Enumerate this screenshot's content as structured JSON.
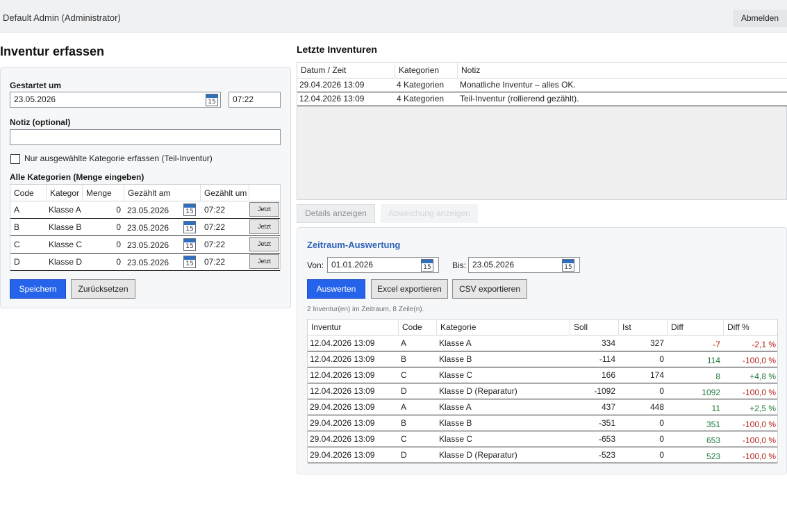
{
  "header": {
    "user": "Default Admin (Administrator)",
    "logout_label": "Abmelden"
  },
  "capture": {
    "title": "Inventur erfassen",
    "started_label": "Gestartet um",
    "started_date": "23.05.2026",
    "started_time": "07:22",
    "calendar_day": "15",
    "note_label": "Notiz (optional)",
    "note_value": "",
    "partial_checkbox_label": "Nur ausgewählte Kategorie erfassen (Teil-Inventur)",
    "categories_label": "Alle Kategorien (Menge eingeben)",
    "columns": [
      "Code",
      "Kategor",
      "Menge",
      "Gezählt am",
      "Gezählt um",
      ""
    ],
    "rows": [
      {
        "code": "A",
        "category": "Klasse A",
        "qty": "0",
        "date": "23.05.2026",
        "time": "07:22",
        "now_label": "Jetzt"
      },
      {
        "code": "B",
        "category": "Klasse B",
        "qty": "0",
        "date": "23.05.2026",
        "time": "07:22",
        "now_label": "Jetzt"
      },
      {
        "code": "C",
        "category": "Klasse C",
        "qty": "0",
        "date": "23.05.2026",
        "time": "07:22",
        "now_label": "Jetzt"
      },
      {
        "code": "D",
        "category": "Klasse D",
        "qty": "0",
        "date": "23.05.2026",
        "time": "07:22",
        "now_label": "Jetzt"
      }
    ],
    "save_label": "Speichern",
    "reset_label": "Zurücksetzen"
  },
  "recent": {
    "title": "Letzte Inventuren",
    "columns": [
      "Datum / Zeit",
      "Kategorien",
      "Notiz"
    ],
    "rows": [
      {
        "datetime": "29.04.2026 13:09",
        "categories": "4 Kategorien",
        "note": "Monatliche Inventur – alles OK."
      },
      {
        "datetime": "12.04.2026 13:09",
        "categories": "4 Kategorien",
        "note": "Teil-Inventur (rollierend gezählt)."
      }
    ],
    "details_label": "Details anzeigen",
    "deviation_label": "Abweichung anzeigen"
  },
  "evaluation": {
    "title": "Zeitraum-Auswertung",
    "from_label": "Von:",
    "from_value": "01.01.2026",
    "to_label": "Bis:",
    "to_value": "23.05.2026",
    "evaluate_label": "Auswerten",
    "excel_label": "Excel exportieren",
    "csv_label": "CSV exportieren",
    "summary": "2 Inventur(en) im Zeitraum, 8 Zeile(n).",
    "columns": [
      "Inventur",
      "Code",
      "Kategorie",
      "Soll",
      "Ist",
      "Diff",
      "Diff %"
    ],
    "rows": [
      {
        "inventur": "12.04.2026 13:09",
        "code": "A",
        "category": "Klasse A",
        "soll": "334",
        "ist": "327",
        "diff": "-7",
        "diff_pct": "-2,1 %"
      },
      {
        "inventur": "12.04.2026 13:09",
        "code": "B",
        "category": "Klasse B",
        "soll": "-114",
        "ist": "0",
        "diff": "114",
        "diff_pct": "-100,0 %"
      },
      {
        "inventur": "12.04.2026 13:09",
        "code": "C",
        "category": "Klasse C",
        "soll": "166",
        "ist": "174",
        "diff": "8",
        "diff_pct": "+4,8 %"
      },
      {
        "inventur": "12.04.2026 13:09",
        "code": "D",
        "category": "Klasse D (Reparatur)",
        "soll": "-1092",
        "ist": "0",
        "diff": "1092",
        "diff_pct": "-100,0 %"
      },
      {
        "inventur": "29.04.2026 13:09",
        "code": "A",
        "category": "Klasse A",
        "soll": "437",
        "ist": "448",
        "diff": "11",
        "diff_pct": "+2,5 %"
      },
      {
        "inventur": "29.04.2026 13:09",
        "code": "B",
        "category": "Klasse B",
        "soll": "-351",
        "ist": "0",
        "diff": "351",
        "diff_pct": "-100,0 %"
      },
      {
        "inventur": "29.04.2026 13:09",
        "code": "C",
        "category": "Klasse C",
        "soll": "-653",
        "ist": "0",
        "diff": "653",
        "diff_pct": "-100,0 %"
      },
      {
        "inventur": "29.04.2026 13:09",
        "code": "D",
        "category": "Klasse D (Reparatur)",
        "soll": "-523",
        "ist": "0",
        "diff": "523",
        "diff_pct": "-100,0 %"
      }
    ]
  },
  "colors": {
    "primary": "#2563eb",
    "section_title": "#2f63b8",
    "negative": "#b42318",
    "positive": "#1f7a3a"
  }
}
